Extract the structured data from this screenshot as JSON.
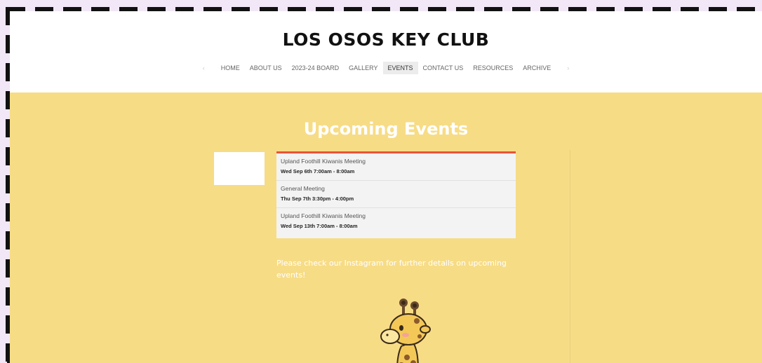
{
  "site": {
    "title": "LOS OSOS KEY CLUB"
  },
  "nav": {
    "items": [
      {
        "label": "HOME"
      },
      {
        "label": "ABOUT US"
      },
      {
        "label": "2023-24 BOARD"
      },
      {
        "label": "GALLERY"
      },
      {
        "label": "EVENTS",
        "active": true
      },
      {
        "label": "CONTACT US"
      },
      {
        "label": "RESOURCES"
      },
      {
        "label": "ARCHIVE"
      }
    ],
    "prev_icon": "chevron-left-icon",
    "next_icon": "chevron-right-icon"
  },
  "events": {
    "heading": "Upcoming Events",
    "accent_color": "#e8543a",
    "list": [
      {
        "name": "Upland Foothill Kiwanis Meeting",
        "time": "Wed Sep 6th 7:00am - 8:00am"
      },
      {
        "name": "General Meeting",
        "time": "Thu Sep 7th 3:30pm - 4:00pm"
      },
      {
        "name": "Upland Foothill Kiwanis Meeting",
        "time": "Wed Sep 13th 7:00am - 8:00am"
      }
    ],
    "note": "Please check our Instagram for further details on upcoming events!"
  },
  "colors": {
    "page_background": "#f7dc86",
    "header_background": "#ffffff",
    "frame_background": "#f1e7f6"
  },
  "mascot": {
    "icon": "giraffe-icon"
  }
}
